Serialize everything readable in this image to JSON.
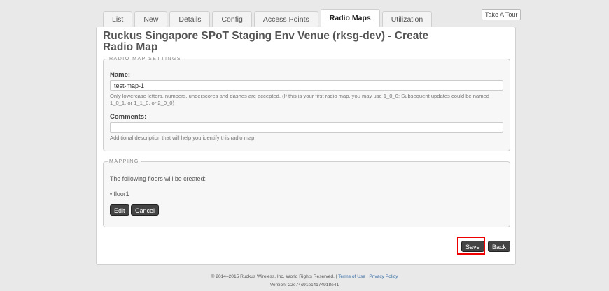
{
  "tabs": [
    {
      "label": "List",
      "active": false
    },
    {
      "label": "New",
      "active": false
    },
    {
      "label": "Details",
      "active": false
    },
    {
      "label": "Config",
      "active": false
    },
    {
      "label": "Access Points",
      "active": false
    },
    {
      "label": "Radio Maps",
      "active": true
    },
    {
      "label": "Utilization",
      "active": false
    }
  ],
  "tour_button": "Take A Tour",
  "page_title": "Ruckus Singapore SPoT Staging Env Venue (rksg-dev) - Create Radio Map",
  "settings": {
    "legend": "RADIO MAP SETTINGS",
    "name_label": "Name:",
    "name_value": "test-map-1",
    "name_help": "Only lowercase letters, numbers, underscores and dashes are accepted. (If this is your first radio map, you may use 1_0_0; Subsequent updates could be named 1_0_1, or 1_1_0, or 2_0_0)",
    "comments_label": "Comments:",
    "comments_value": "",
    "comments_help": "Additional description that will help you identify this radio map."
  },
  "mapping": {
    "legend": "MAPPING",
    "intro": "The following floors will be created:",
    "floors": [
      "floor1"
    ],
    "edit_button": "Edit",
    "cancel_button": "Cancel"
  },
  "actions": {
    "save_button": "Save",
    "back_button": "Back"
  },
  "footer": {
    "copyright": "© 2014–2015 Ruckus Wireless, Inc. World Rights Reserved. |",
    "terms_link": "Terms of Use",
    "separator": "|",
    "privacy_link": "Privacy Policy",
    "version": "Version: 22e74c91ec4174918e41"
  },
  "colors": {
    "button_bg": "#444444",
    "highlight": "#e00000",
    "link": "#3a6ea5"
  }
}
